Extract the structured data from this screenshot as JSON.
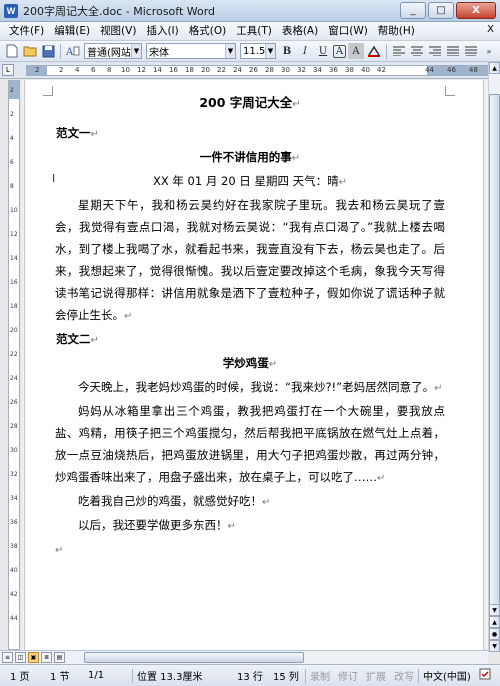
{
  "window": {
    "title": "200字周记大全.doc - Microsoft Word",
    "app_icon": "W",
    "buttons": [
      "_",
      "□",
      "X"
    ]
  },
  "menu": {
    "items": [
      "文件(F)",
      "编辑(E)",
      "视图(V)",
      "插入(I)",
      "格式(O)",
      "工具(T)",
      "表格(A)",
      "窗口(W)",
      "帮助(H)"
    ],
    "close": "X"
  },
  "toolbar": {
    "style_value": "普通(网站)",
    "font_value": "宋体",
    "size_value": "11.5",
    "bold": "B",
    "italic": "I",
    "underline": "U",
    "font_color": "A",
    "char_border": "A"
  },
  "ruler": {
    "h_labels": [
      "2",
      "2",
      "4",
      "6",
      "8",
      "10",
      "12",
      "14",
      "16",
      "18",
      "20",
      "22",
      "24",
      "26",
      "28",
      "30",
      "32",
      "34",
      "36",
      "38",
      "40",
      "42",
      "44",
      "46",
      "48"
    ],
    "v_labels": [
      "2",
      "2",
      "4",
      "6",
      "8",
      "10",
      "12",
      "14",
      "16",
      "18",
      "20",
      "22",
      "24",
      "26",
      "28",
      "30",
      "32",
      "34",
      "36",
      "38",
      "40",
      "42",
      "44"
    ]
  },
  "document": {
    "title": "200 字周记大全",
    "section1": "范文一",
    "heading1": "一件不讲信用的事",
    "dateline": "XX 年 01 月 20 日 星期四 天气：晴",
    "para1": "星期天下午，我和杨云昊约好在我家院子里玩。我去和杨云昊玩了壹会，我觉得有壹点口渴，我就对杨云昊说：“我有点口渴了。”我就上楼去喝水，到了楼上我喝了水，就看起书来，我壹直没有下去，杨云昊也走了。后来，我想起来了，觉得很惭愧。我以后壹定要改掉这个毛病，象我今天写得读书笔记说得那样：讲信用就象是洒下了壹粒种子，假如你说了谎话种子就会停止生长。",
    "section2": "范文二",
    "heading2": "学炒鸡蛋",
    "para2": "今天晚上，我老妈炒鸡蛋的时候，我说：“我来炒?!”老妈居然同意了。",
    "para3": "妈妈从冰箱里拿出三个鸡蛋，教我把鸡蛋打在一个大碗里，要我放点盐、鸡精，用筷子把三个鸡蛋搅匀，然后帮我把平底锅放在燃气灶上点着，放一点豆油烧热后，把鸡蛋放进锅里，用大勺子把鸡蛋炒散，再过两分钟，炒鸡蛋香味出来了，用盘子盛出来，放在桌子上，可以吃了……",
    "para4": "吃着我自己炒的鸡蛋，就感觉好吃！",
    "para5": "以后，我还要学做更多东西！",
    "para_mark": "↵",
    "cursor": "I"
  },
  "status": {
    "page": "1 页",
    "section": "1 节",
    "page_of": "1/1",
    "position": "位置 13.3厘米",
    "line": "13 行",
    "column": "15 列",
    "rec": "录制",
    "trk": "修订",
    "ext": "扩展",
    "ovr": "改写",
    "language": "中文(中国)"
  },
  "colors": {
    "accent": "#2b5fb4",
    "close_button": "#c4432f"
  }
}
